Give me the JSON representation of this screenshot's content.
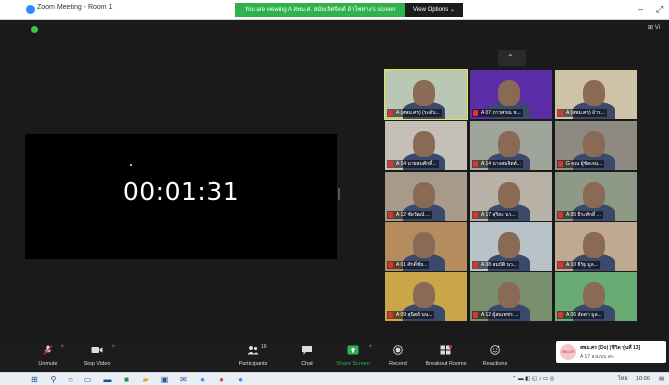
{
  "titlebar": {
    "title": "Zoom Meeting - Room 1",
    "viewing_banner": "You are viewing A สพม.ศ. สมัยเลิศจิตต์ อำไพท่าง's screen",
    "view_options": "View Options ⌄",
    "minimize": "–",
    "fullscreen": "⤢"
  },
  "top": {
    "gallery_view": "⊞ Vi"
  },
  "screen": {
    "timer": "00:01:31"
  },
  "gallery": {
    "collapse": "⌃",
    "tiles": [
      {
        "name": "A (สพม.ศร) (ระดับ...",
        "active": true,
        "bg": "#b9c7b5"
      },
      {
        "name": "A 07 ภาวศรณ ห...",
        "active": false,
        "bg": "#5b2ea8"
      },
      {
        "name": "A (สพม.ศร) อ้าร...",
        "active": false,
        "bg": "#cfc3a7"
      },
      {
        "name": "A 14 นายสมศักดิ์...",
        "active": false,
        "bg": "#c4c0b8"
      },
      {
        "name": "A 14 นางสมจิตต์...",
        "active": false,
        "bg": "#9fa59a"
      },
      {
        "name": "G คุณ ผู้ชัดเจน...",
        "active": false,
        "bg": "#8e8a82"
      },
      {
        "name": "A 12 ชัยวัฒน์ ...",
        "active": false,
        "bg": "#a79a8a"
      },
      {
        "name": "A 17 สุริยะ นว...",
        "active": false,
        "bg": "#b8b2a6"
      },
      {
        "name": "A 05 ธีระศักดิ์ ...",
        "active": false,
        "bg": "#8f9a86"
      },
      {
        "name": "A 01 ศักดิ์ชัย...",
        "active": false,
        "bg": "#b58c5e"
      },
      {
        "name": "A 08 สมบัติ นว...",
        "active": false,
        "bg": "#b7c2c9"
      },
      {
        "name": "A 10 ธีรัฐ มูล...",
        "active": false,
        "bg": "#c0a991"
      },
      {
        "name": "A 09 สุนิตย์ นน...",
        "active": false,
        "bg": "#caa64a"
      },
      {
        "name": "A 12 ผู้สมเพชร ...",
        "active": false,
        "bg": "#7a8f6e"
      },
      {
        "name": "A 06 ลัดดา มูล...",
        "active": false,
        "bg": "#69ab72"
      }
    ]
  },
  "toolbar": {
    "unmute": "Unmute",
    "stop_video": "Stop Video",
    "participants": "Participants",
    "participants_count": "19",
    "chat": "Chat",
    "share_screen": "Share Screen",
    "record": "Record",
    "breakout_rooms": "Breakout Rooms",
    "reactions": "Reactions"
  },
  "notification": {
    "avatar_text": "สพม.ศร",
    "from": "สพม.ศร (Do) [ชีวิต รุ่นที่ 13]",
    "message": "A 17 ลงแบบ ค่ะ"
  },
  "taskbar": {
    "tray_time": "10:00",
    "tray_lang": "ไทย"
  },
  "colors": {
    "zoom_blue": "#2d8cff",
    "viewing_green": "#2fb24c",
    "active_speaker": "#e5e34a",
    "share_green": "#2fb24c",
    "muted_red": "#e03030"
  }
}
